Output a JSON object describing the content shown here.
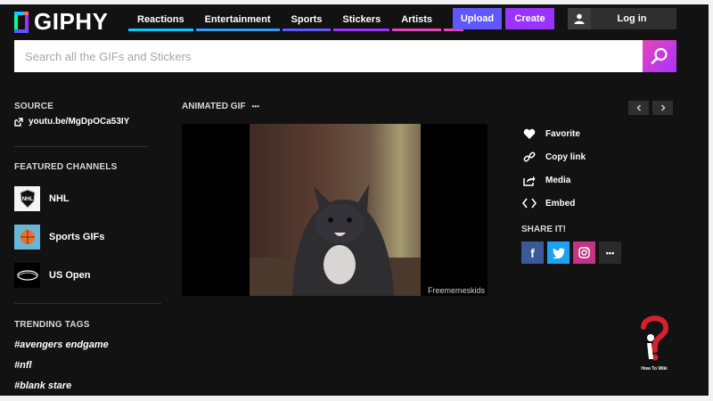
{
  "header": {
    "logo_text": "GIPHY",
    "nav": [
      {
        "label": "Reactions",
        "color": "#00ccff"
      },
      {
        "label": "Entertainment",
        "color": "#3399ff"
      },
      {
        "label": "Sports",
        "color": "#6157ff"
      },
      {
        "label": "Stickers",
        "color": "#9933ff"
      },
      {
        "label": "Artists",
        "color": "#e646b6"
      }
    ],
    "more_label": "⋮",
    "upload_label": "Upload",
    "create_label": "Create",
    "login_label": "Log in"
  },
  "search": {
    "placeholder": "Search all the GIFs and Stickers"
  },
  "source": {
    "heading": "SOURCE",
    "link": "youtu.be/MgDpOCa53IY"
  },
  "featured": {
    "heading": "FEATURED CHANNELS",
    "channels": [
      {
        "name": "NHL"
      },
      {
        "name": "Sports GIFs"
      },
      {
        "name": "US Open"
      }
    ]
  },
  "trending": {
    "heading": "TRENDING TAGS",
    "tags": [
      "#avengers endgame",
      "#nfl",
      "#blank stare"
    ]
  },
  "main": {
    "label": "ANIMATED GIF",
    "dots": "•••",
    "watermark": "Freememeskids"
  },
  "actions": {
    "favorite": "Favorite",
    "copy_link": "Copy link",
    "media": "Media",
    "embed": "Embed",
    "share_heading": "SHARE IT!",
    "more": "•••"
  },
  "help_badge": {
    "caption": "How To Wiki"
  }
}
